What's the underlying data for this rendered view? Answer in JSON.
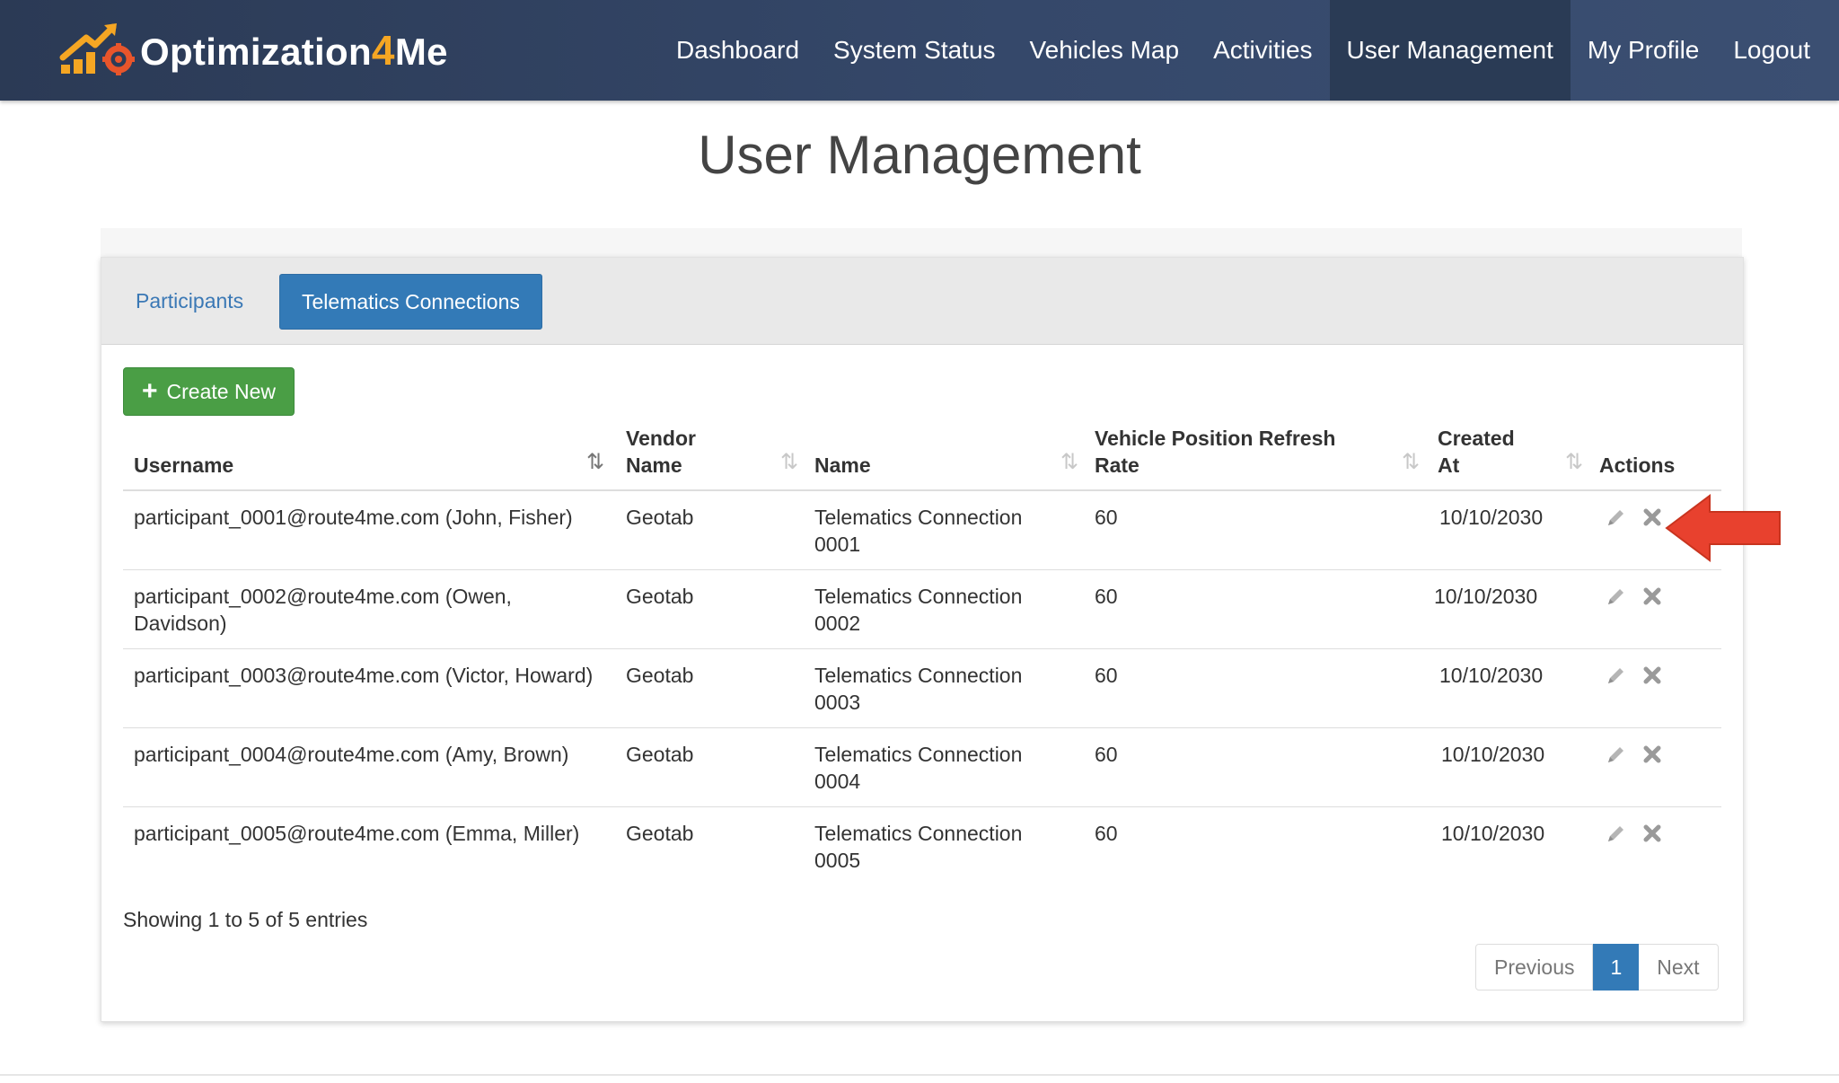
{
  "brand": {
    "name_part1": "Optimization",
    "name_part2": "4",
    "name_part3": "Me"
  },
  "nav": {
    "items": [
      {
        "label": "Dashboard"
      },
      {
        "label": "System Status"
      },
      {
        "label": "Vehicles Map"
      },
      {
        "label": "Activities"
      },
      {
        "label": "User Management"
      },
      {
        "label": "My Profile"
      },
      {
        "label": "Logout"
      }
    ],
    "active": "User Management"
  },
  "page": {
    "title": "User Management"
  },
  "tabs": [
    {
      "label": "Participants"
    },
    {
      "label": "Telematics Connections"
    }
  ],
  "active_tab": "Telematics Connections",
  "toolbar": {
    "create_label": "Create New"
  },
  "table": {
    "columns": [
      {
        "label_line1": "",
        "label_line2": "Username"
      },
      {
        "label_line1": "Vendor",
        "label_line2": "Name"
      },
      {
        "label_line1": "",
        "label_line2": "Name"
      },
      {
        "label_line1": "Vehicle Position Refresh",
        "label_line2": "Rate"
      },
      {
        "label_line1": "Created",
        "label_line2": "At"
      },
      {
        "label_line1": "",
        "label_line2": "Actions"
      }
    ],
    "rows": [
      {
        "username": "participant_0001@route4me.com (John, Fisher)",
        "vendor": "Geotab",
        "name": "Telematics Connection 0001",
        "rate": "60",
        "created": "10/10/2030"
      },
      {
        "username": "participant_0002@route4me.com (Owen, Davidson)",
        "vendor": "Geotab",
        "name": "Telematics Connection 0002",
        "rate": "60",
        "created": "10/10/2030"
      },
      {
        "username": "participant_0003@route4me.com (Victor, Howard)",
        "vendor": "Geotab",
        "name": "Telematics Connection 0003",
        "rate": "60",
        "created": "10/10/2030"
      },
      {
        "username": "participant_0004@route4me.com (Amy, Brown)",
        "vendor": "Geotab",
        "name": "Telematics Connection 0004",
        "rate": "60",
        "created": "10/10/2030"
      },
      {
        "username": "participant_0005@route4me.com (Emma, Miller)",
        "vendor": "Geotab",
        "name": "Telematics Connection 0005",
        "rate": "60",
        "created": "10/10/2030"
      }
    ]
  },
  "footer": {
    "entries_info": "Showing 1 to 5 of 5 entries",
    "pagination": {
      "previous": "Previous",
      "current": "1",
      "next": "Next"
    }
  },
  "icons": {
    "edit": "pencil-icon",
    "delete": "close-icon",
    "sort": "sort-icon",
    "sort_active": "sort-ascending-icon",
    "callout": "arrow-left-icon"
  },
  "colors": {
    "nav_bg": "#35486a",
    "primary": "#337ab7",
    "success": "#4a9e45",
    "brand_accent": "#f5a623",
    "callout": "#e8412e"
  }
}
